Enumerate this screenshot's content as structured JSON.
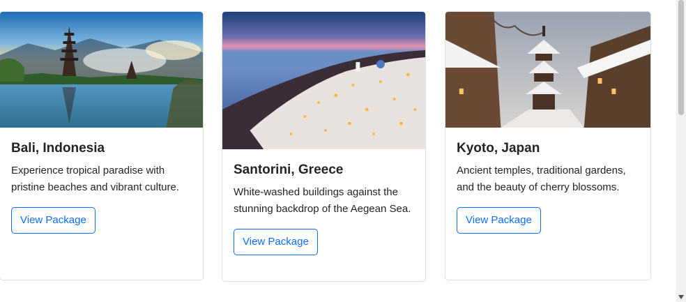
{
  "cards": [
    {
      "title": "Bali, Indonesia",
      "text": "Experience tropical paradise with pristine beaches and vibrant culture.",
      "button_label": "View Package",
      "image_alt": "bali-temple-lake-image"
    },
    {
      "title": "Santorini, Greece",
      "text": "White-washed buildings against the stunning backdrop of the Aegean Sea.",
      "button_label": "View Package",
      "image_alt": "santorini-village-sea-image"
    },
    {
      "title": "Kyoto, Japan",
      "text": "Ancient temples, traditional gardens, and the beauty of cherry blossoms.",
      "button_label": "View Package",
      "image_alt": "kyoto-snowy-street-pagoda-image"
    }
  ],
  "colors": {
    "button_border": "#0d6efd",
    "button_text": "#0d6efd",
    "card_border": "#dcdfe3"
  }
}
